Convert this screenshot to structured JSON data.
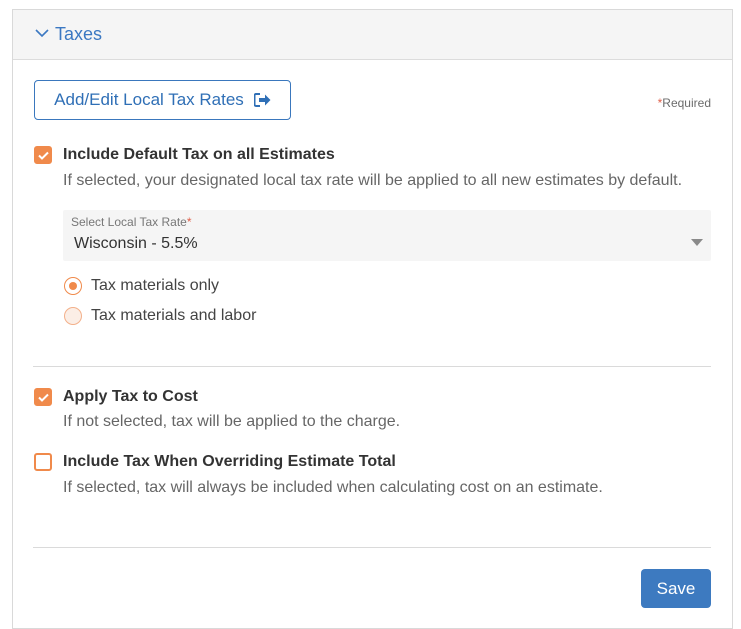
{
  "panel": {
    "title": "Taxes"
  },
  "add_button": {
    "label": "Add/Edit Local Tax Rates",
    "icon": "external-link-icon"
  },
  "required_note": {
    "star": "*",
    "text": "Required"
  },
  "default_tax": {
    "checked": true,
    "title": "Include Default Tax on all Estimates",
    "description": "If selected, your designated local tax rate will be applied to all new estimates by default."
  },
  "tax_rate_select": {
    "label": "Select Local Tax Rate",
    "required_star": "*",
    "value": "Wisconsin - 5.5%"
  },
  "tax_scope": {
    "options": [
      {
        "label": "Tax materials only",
        "selected": true
      },
      {
        "label": "Tax materials and labor",
        "selected": false
      }
    ]
  },
  "apply_tax_to_cost": {
    "checked": true,
    "title": "Apply Tax to Cost",
    "description": "If not selected, tax will be applied to the charge."
  },
  "override_total": {
    "checked": false,
    "title": "Include Tax When Overriding Estimate Total",
    "description": "If selected, tax will always be included when calculating cost on an estimate."
  },
  "save_button": {
    "label": "Save"
  },
  "colors": {
    "accent": "#f08a4b",
    "primary": "#3d7ac0",
    "required": "#e0604a"
  }
}
